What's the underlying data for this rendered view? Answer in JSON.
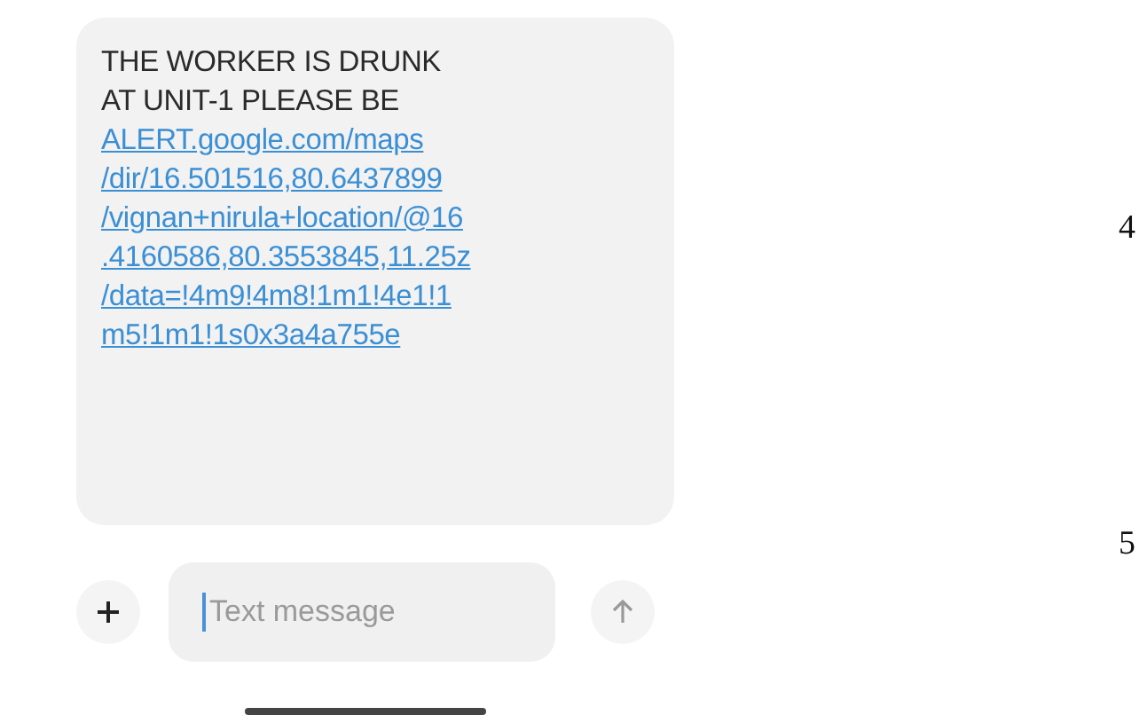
{
  "message": {
    "text_lines": [
      "THE WORKER IS DRUNK",
      "AT UNIT-1 PLEASE BE"
    ],
    "link_lines": [
      "ALERT.google.com/maps",
      "/dir/16.501516,80.6437899",
      "/vignan+nirula+location/@16",
      ".4160586,80.3553845,11.25z",
      "/data=!4m9!4m8!1m1!4e1!1",
      "m5!1m1!1s0x3a4a755e"
    ]
  },
  "composer": {
    "placeholder": "Text message"
  },
  "page_numbers": [
    "4",
    "5"
  ]
}
